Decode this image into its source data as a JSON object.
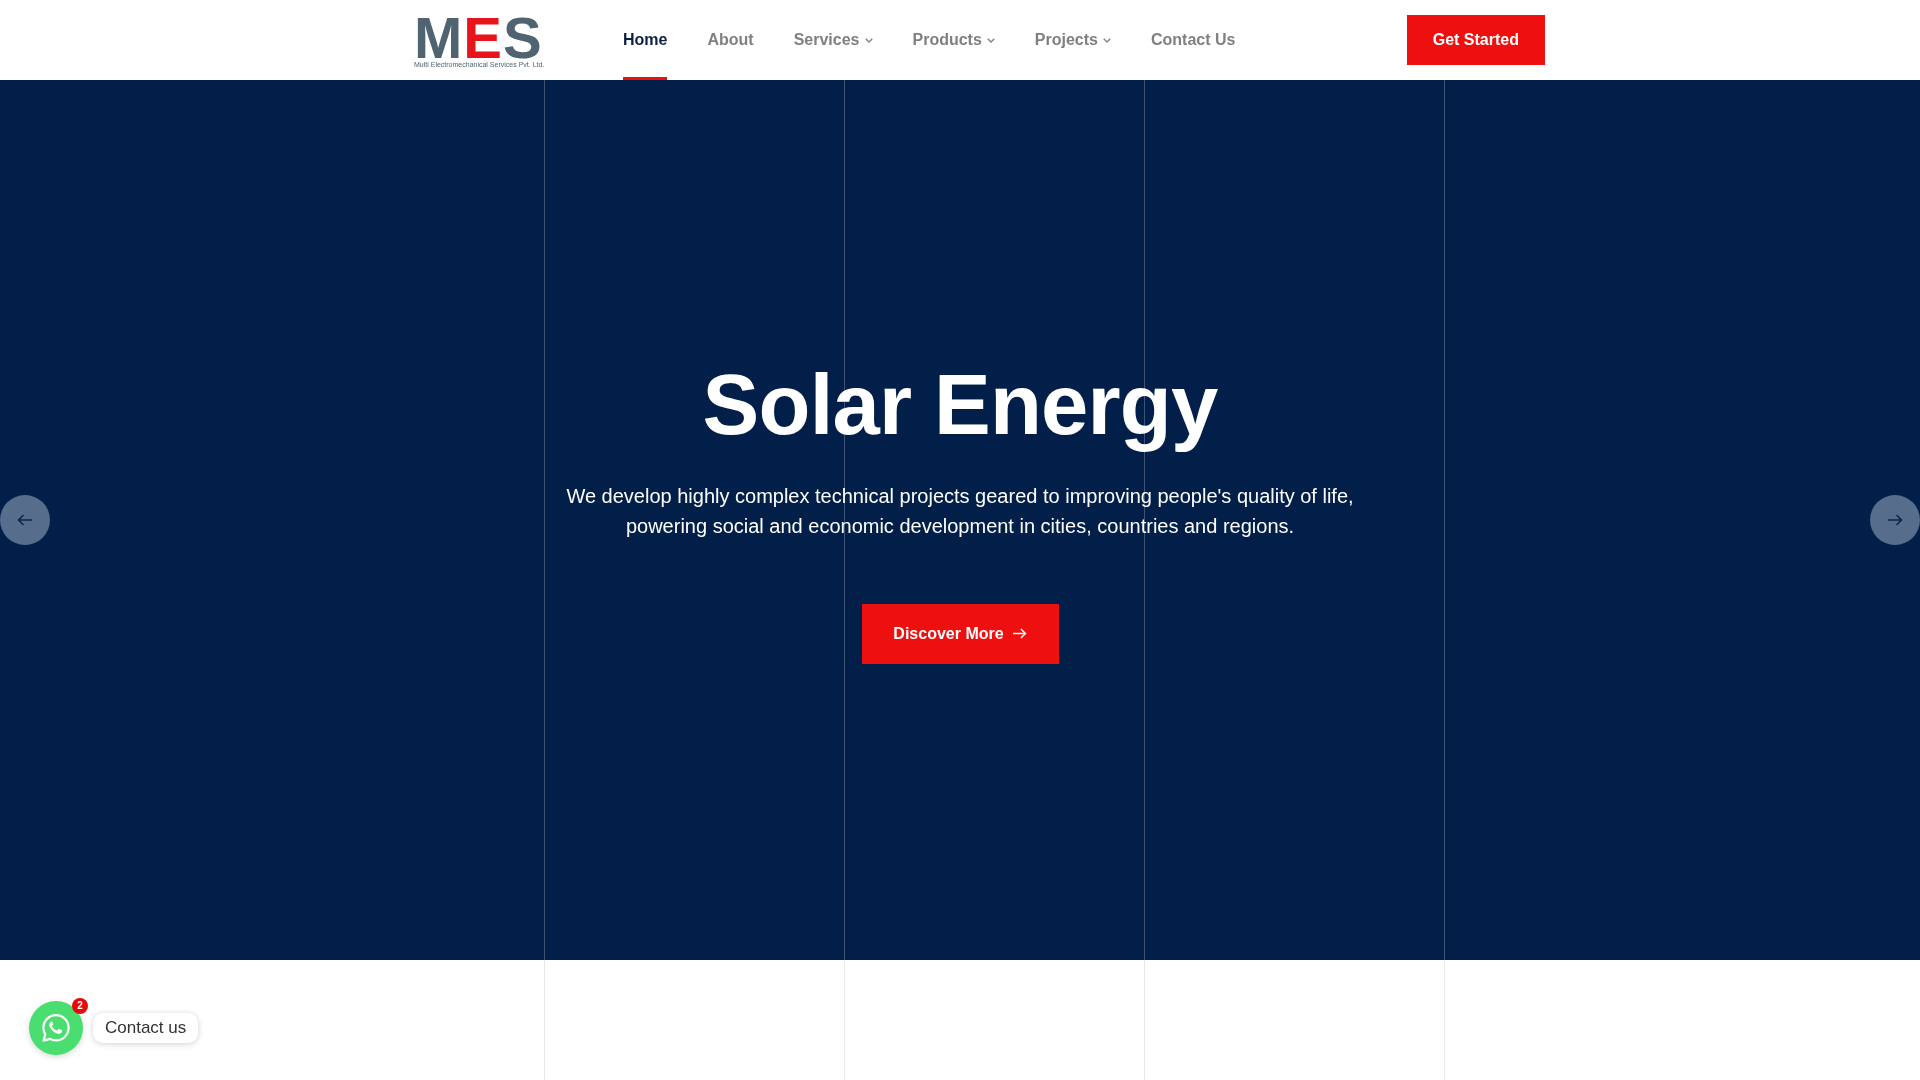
{
  "header": {
    "logo": {
      "letters": [
        {
          "char": "M",
          "color": "#4f6370"
        },
        {
          "char": "E",
          "color": "#e8141b"
        },
        {
          "char": "S",
          "color": "#4f6370"
        }
      ],
      "tagline": "Multi Electromechanical Services Pvt. Ltd."
    },
    "nav": [
      {
        "label": "Home",
        "selected": true,
        "has_menu": false
      },
      {
        "label": "About",
        "selected": false,
        "has_menu": false
      },
      {
        "label": "Services",
        "selected": false,
        "has_menu": true
      },
      {
        "label": "Products",
        "selected": false,
        "has_menu": true
      },
      {
        "label": "Projects",
        "selected": false,
        "has_menu": true
      },
      {
        "label": "Contact Us",
        "selected": false,
        "has_menu": false
      }
    ],
    "cta": "Get Started"
  },
  "hero": {
    "title": "Solar Energy",
    "text": "We develop highly complex technical projects geared to improving people's quality of life, powering social and economic development in cities, countries and regions.",
    "button": "Discover More"
  },
  "chat_widget": {
    "badge": "2",
    "label": "Contact us"
  }
}
